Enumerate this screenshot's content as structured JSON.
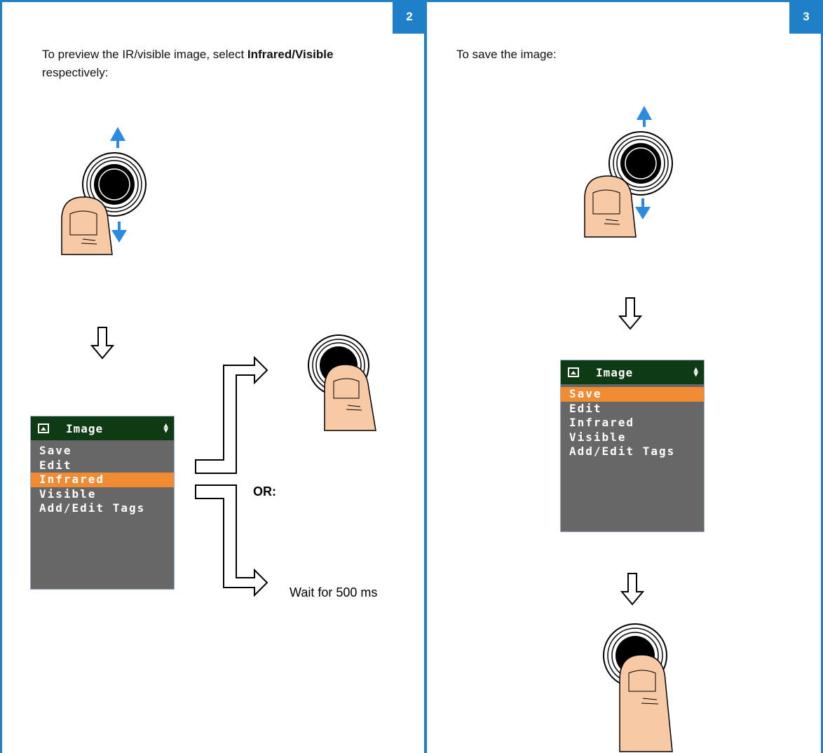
{
  "panel_left": {
    "step": "2",
    "instruction": {
      "prefix": "To preview the IR/visible image, select ",
      "option1": "Infrared",
      "sep": "/",
      "option2": "Visible",
      "suffix": " respectively:"
    },
    "menu": {
      "title": "Image",
      "items": [
        "Save",
        "Edit",
        "Infrared",
        "Visible",
        "Add/Edit Tags"
      ],
      "selected": "Infrared"
    },
    "or_label": "OR:",
    "wait_label": "Wait for 500 ms"
  },
  "panel_right": {
    "step": "3",
    "instruction": "To save the image:",
    "menu": {
      "title": "Image",
      "items": [
        "Save",
        "Edit",
        "Infrared",
        "Visible",
        "Add/Edit Tags"
      ],
      "selected": "Save"
    }
  },
  "colors": {
    "accent": "#1f7fc7",
    "menu_header": "#0e3a14",
    "menu_body": "#676767",
    "highlight": "#f08a33",
    "thumb": "#f7c9a4",
    "arrow_blue": "#2a8be0"
  },
  "icons": [
    "joystick-icon",
    "thumb-icon",
    "arrow-up-icon",
    "arrow-down-icon",
    "down-flow-arrow-icon",
    "image-icon"
  ]
}
